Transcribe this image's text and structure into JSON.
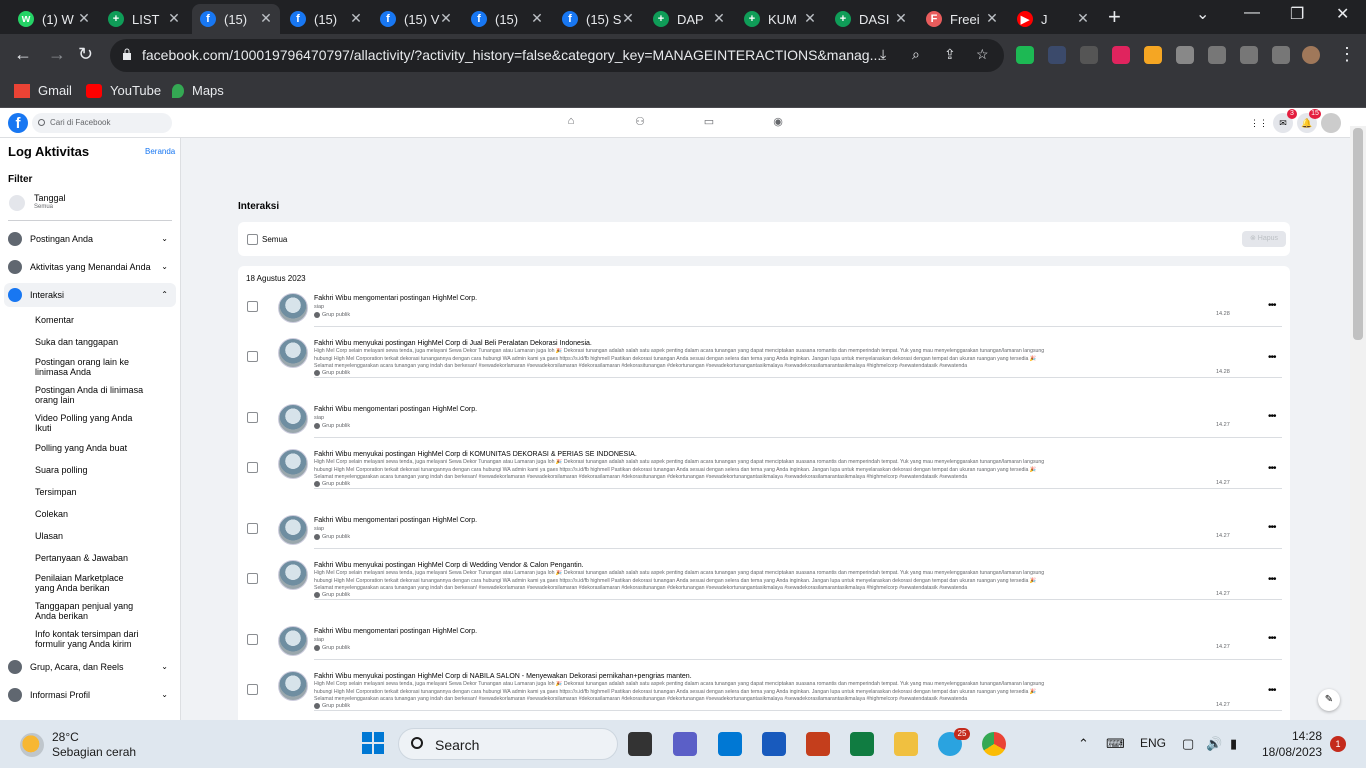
{
  "browser": {
    "tabs": [
      {
        "title": "(1) W",
        "icon": "whatsapp-icon",
        "color": "#25d366",
        "glyph": "w"
      },
      {
        "title": "LIST",
        "icon": "sheets-icon",
        "color": "#0f9d58",
        "glyph": "+"
      },
      {
        "title": "(15)",
        "icon": "facebook-icon",
        "color": "#1877f2",
        "glyph": "f",
        "active": true
      },
      {
        "title": "(15)",
        "icon": "facebook-icon",
        "color": "#1877f2",
        "glyph": "f"
      },
      {
        "title": "(15) V",
        "icon": "facebook-icon",
        "color": "#1877f2",
        "glyph": "f"
      },
      {
        "title": "(15)",
        "icon": "facebook-icon",
        "color": "#1877f2",
        "glyph": "f"
      },
      {
        "title": "(15) S",
        "icon": "facebook-icon",
        "color": "#1877f2",
        "glyph": "f"
      },
      {
        "title": "DAP",
        "icon": "sheets-icon",
        "color": "#0f9d58",
        "glyph": "+"
      },
      {
        "title": "KUM",
        "icon": "sheets-icon",
        "color": "#0f9d58",
        "glyph": "+"
      },
      {
        "title": "DASI",
        "icon": "sheets-icon",
        "color": "#0f9d58",
        "glyph": "+"
      },
      {
        "title": "Freei",
        "icon": "freepik-icon",
        "color": "#e85c5c",
        "glyph": "F"
      },
      {
        "title": "J",
        "icon": "youtube-icon",
        "color": "#ff0000",
        "glyph": "▶"
      }
    ],
    "url": "facebook.com/100019796470797/allactivity/?activity_history=false&category_key=MANAGEINTERACTIONS&manag...",
    "bookmarks": [
      {
        "label": "Gmail",
        "icon": "gmail-icon"
      },
      {
        "label": "YouTube",
        "icon": "youtube-icon"
      },
      {
        "label": "Maps",
        "icon": "maps-icon"
      }
    ]
  },
  "facebook": {
    "search_placeholder": "Cari di Facebook",
    "messenger_badge": "3",
    "notif_badge": "15"
  },
  "sidebar": {
    "title": "Log Aktivitas",
    "home_link": "Beranda",
    "filter_label": "Filter",
    "date_filter": {
      "label": "Tanggal",
      "value": "Semua"
    },
    "sections": [
      {
        "label": "Postingan Anda",
        "icon": "post-icon"
      },
      {
        "label": "Aktivitas yang Menandai Anda",
        "icon": "tag-icon"
      },
      {
        "label": "Interaksi",
        "icon": "like-icon",
        "selected": true
      }
    ],
    "sub_items": [
      "Komentar",
      "Suka dan tanggapan",
      "Postingan orang lain ke linimasa Anda",
      "Postingan Anda di linimasa orang lain",
      "Video Polling yang Anda Ikuti",
      "Polling yang Anda buat",
      "Suara polling",
      "Tersimpan",
      "Colekan",
      "Ulasan",
      "Pertanyaan & Jawaban",
      "Penilaian Marketplace yang Anda berikan",
      "Tanggapan penjual yang Anda berikan",
      "Info kontak tersimpan dari formulir yang Anda kirim"
    ],
    "bottom_sections": [
      {
        "label": "Grup, Acara, dan Reels",
        "icon": "group-icon"
      },
      {
        "label": "Informasi Profil",
        "icon": "profile-icon"
      }
    ]
  },
  "main": {
    "title": "Interaksi",
    "select_all": "Semua",
    "delete_button": "Hapus",
    "date_heading": "18 Agustus 2023",
    "post_text_line1": "High Mel Corp selain melayani sewa tenda, juga melayani Sewa Dekor Tunangan atau Lamaran juga loh 🎉 Dekorasi tunangan adalah salah satu aspek penting dalam acara tunangan yang dapat menciptakan suasana romantis dan memperindah tempat. Yuk yang mau menyelenggarakan tunangan/lamaran langsung",
    "post_text_line2": "hubungi High Mel Corporation terkait dekorasi tunangannya dengan cara hubungi WA admin kami ya gaes https://s.id/fb highmell Pastikan dekorasi tunangan Anda sesuai dengan selera dan tema yang Anda inginkan. Jangan lupa untuk menyelaraskan dekorasi dengan tempat dan ukuran ruangan yang tersedia 🎉",
    "post_text_line3": "Selamat menyelenggarakan acara tunangan yang indah dan berkesan! #sewadekorlamaran #sewadekorsilamaran #dekorasilamaran #dekorasitunangan #dekortunangan #sewadekortunangantasikmalaya #sewadekorasilamarantasikmalaya #highmelcorp #sewatendatasik #sewatenda",
    "activities": [
      {
        "actor": "Fakhri Wibu",
        "verb": "mengomentari postingan",
        "target": "HighMel Corp",
        "group": "",
        "comment": "siap",
        "audience": "Grup publik",
        "time": "14.28",
        "long": false
      },
      {
        "actor": "Fakhri Wibu",
        "verb": "menyukai postingan",
        "target": "HighMel Corp",
        "group": "Jual Beli Peralatan Dekorasi Indonesia",
        "comment": "",
        "audience": "Grup publik",
        "time": "14.28",
        "long": true
      },
      {
        "actor": "Fakhri Wibu",
        "verb": "mengomentari postingan",
        "target": "HighMel Corp",
        "group": "",
        "comment": "siap",
        "audience": "Grup publik",
        "time": "14.27",
        "long": false
      },
      {
        "actor": "Fakhri Wibu",
        "verb": "menyukai postingan",
        "target": "HighMel Corp",
        "group": "KOMUNITAS DEKORASI & PERIAS SE INDONESIA",
        "comment": "",
        "audience": "Grup publik",
        "time": "14.27",
        "long": true
      },
      {
        "actor": "Fakhri Wibu",
        "verb": "mengomentari postingan",
        "target": "HighMel Corp",
        "group": "",
        "comment": "siap",
        "audience": "Grup publik",
        "time": "14.27",
        "long": false
      },
      {
        "actor": "Fakhri Wibu",
        "verb": "menyukai postingan",
        "target": "HighMel Corp",
        "group": "Wedding Vendor & Calon Pengantin",
        "comment": "",
        "audience": "Grup publik",
        "time": "14.27",
        "long": true
      },
      {
        "actor": "Fakhri Wibu",
        "verb": "mengomentari postingan",
        "target": "HighMel Corp",
        "group": "",
        "comment": "siap",
        "audience": "Grup publik",
        "time": "14.27",
        "long": false
      },
      {
        "actor": "Fakhri Wibu",
        "verb": "menyukai postingan",
        "target": "HighMel Corp",
        "group": "NABILA SALON - Menyewakan Dekorasi pernikahan+pengrias manten",
        "comment": "",
        "audience": "Grup publik",
        "time": "14.27",
        "long": true
      }
    ]
  },
  "taskbar": {
    "weather_temp": "28°C",
    "weather_desc": "Sebagian cerah",
    "search_label": "Search",
    "telegram_badge": "25",
    "language": "ENG",
    "time": "14:28",
    "date": "18/08/2023",
    "notifications": "1"
  }
}
